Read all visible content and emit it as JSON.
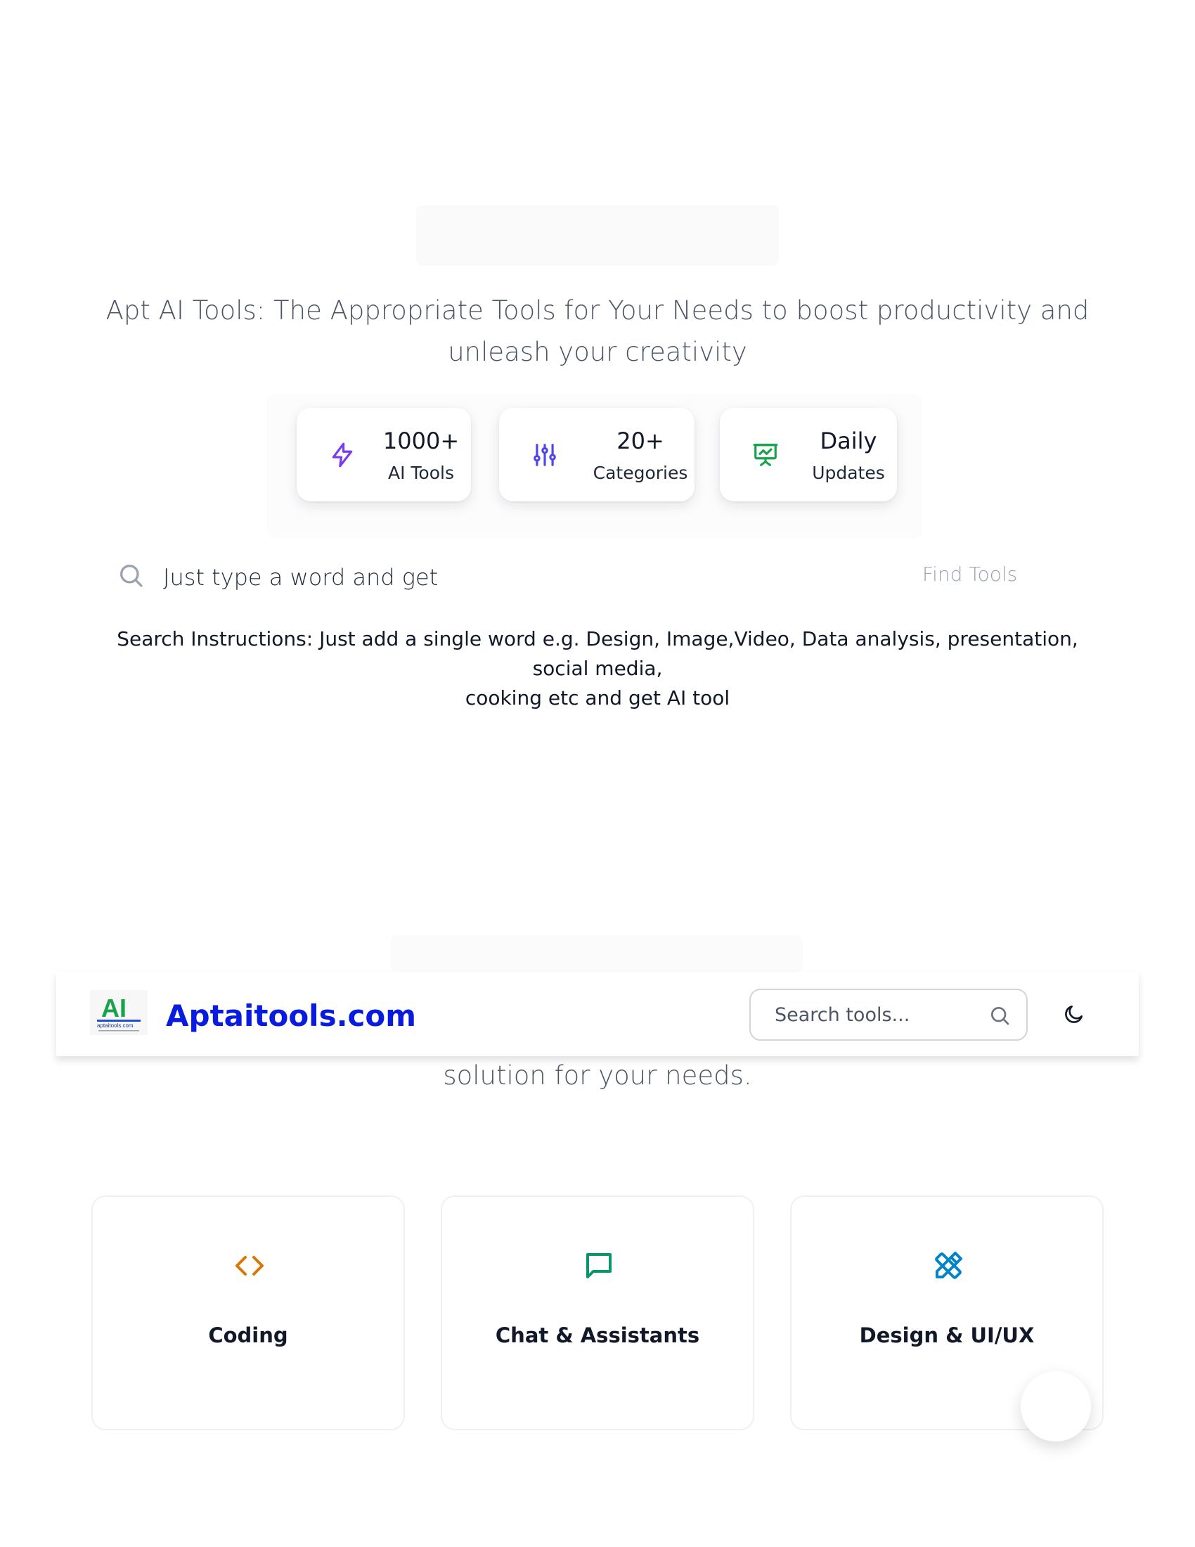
{
  "hero": {
    "tagline_line1": "Apt AI Tools: The Appropriate Tools for Your Needs to boost productivity and",
    "tagline_line2": "unleash your creativity"
  },
  "stats": [
    {
      "value": "1000+",
      "label": "AI Tools",
      "icon": "lightning-icon",
      "color": "#7c3aed"
    },
    {
      "value": "20+",
      "label": "Categories",
      "icon": "sliders-icon",
      "color": "#4f46e5"
    },
    {
      "value": "Daily",
      "label": "Updates",
      "icon": "presentation-chart-icon",
      "color": "#16a34a"
    }
  ],
  "search": {
    "query": "Just type a word and get",
    "button_label": "Find Tools",
    "icon": "search-icon"
  },
  "instructions": {
    "line1": "Search Instructions: Just add a single word e.g. Design, Image,Video, Data analysis, presentation, social media,",
    "line2": "cooking etc and get AI tool"
  },
  "navbar": {
    "logo_text": "AI",
    "logo_subtext": "aptaitools.com",
    "brand": "Aptaitools.com",
    "brand_color": "#0a1be0",
    "search_placeholder": "Search tools...",
    "theme_icon": "moon-icon"
  },
  "section": {
    "subtitle_fragment": "solution for your needs."
  },
  "categories": [
    {
      "name": "Coding",
      "icon": "code-icon",
      "color": "#d97706"
    },
    {
      "name": "Chat & Assistants",
      "icon": "chat-bubble-icon",
      "color": "#059669"
    },
    {
      "name": "Design & UI/UX",
      "icon": "pencil-ruler-icon",
      "color": "#0284c7"
    }
  ]
}
